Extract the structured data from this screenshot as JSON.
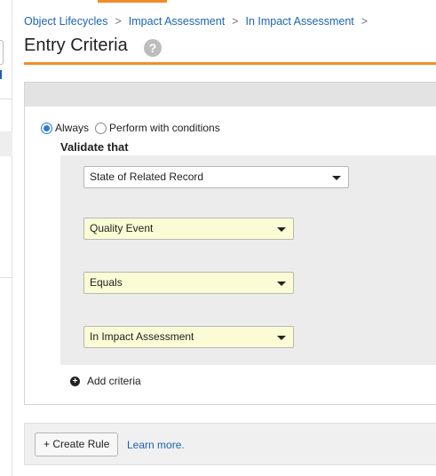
{
  "breadcrumb": {
    "items": [
      "Object Lifecycles",
      "Impact Assessment",
      "In Impact Assessment"
    ],
    "separator": ">"
  },
  "page": {
    "title": "Entry Criteria",
    "help_icon_glyph": "?"
  },
  "criteria": {
    "options": {
      "always_label": "Always",
      "conditions_label": "Perform with conditions",
      "selected": "Always"
    },
    "validate_label": "Validate that",
    "fields": {
      "subject": "State of Related Record",
      "object": "Quality Event",
      "operator": "Equals",
      "value": "In Impact Assessment"
    },
    "add_criteria_label": "Add criteria",
    "add_icon_glyph": "+"
  },
  "footer": {
    "create_rule_label": "+ Create Rule",
    "learn_more_label": "Learn more."
  },
  "colors": {
    "accent": "#f28c28",
    "link": "#1a64b4",
    "highlight_field": "#fbfbd5"
  }
}
